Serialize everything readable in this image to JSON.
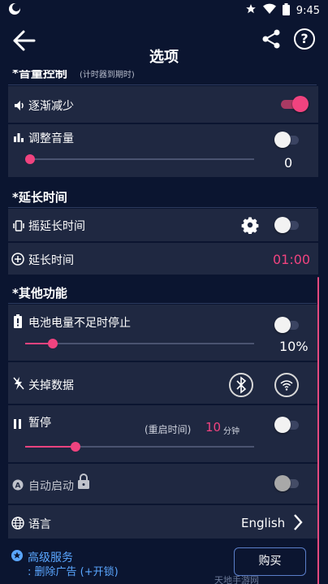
{
  "status_bar": {
    "time": "9:45"
  },
  "app_bar": {
    "title": "选项",
    "help_label": "?"
  },
  "sections": {
    "volume_control": {
      "header": "*音量控制",
      "header_note": "(计时器到期时)"
    },
    "extend_time": {
      "header": "*延长时间"
    },
    "other": {
      "header": "*其他功能"
    }
  },
  "settings": {
    "fade_out": {
      "label": "逐渐减少",
      "enabled": true
    },
    "adjust_volume": {
      "label": "调整音量",
      "enabled": false,
      "level": 0,
      "level_text": "0"
    },
    "shake_extend": {
      "label": "摇延长时间",
      "enabled": false
    },
    "extend_time": {
      "label": "延长时间",
      "value": "01:00"
    },
    "battery_stop": {
      "label": "电池电量不足时停止",
      "enabled": false,
      "level_text": "10%",
      "level": 10
    },
    "turn_off_data": {
      "label": "关掉数据"
    },
    "pause": {
      "label": "暂停",
      "restart_label": "(重启时间)",
      "restart_value": "10",
      "restart_unit": "分钟",
      "enabled": false,
      "level": 20
    },
    "auto_start": {
      "label": "自动启动",
      "enabled": false,
      "locked": true
    },
    "language": {
      "label": "语言",
      "value": "English"
    }
  },
  "premium": {
    "title": "高级服务",
    "subtitle": ": 删除广告 (+开锁)",
    "buy_label": "购买"
  },
  "watermark": "天地手游网",
  "colors": {
    "background": "#0b1530",
    "card": "#1f2841",
    "accent": "#f0437f",
    "link": "#5aa6ff"
  }
}
